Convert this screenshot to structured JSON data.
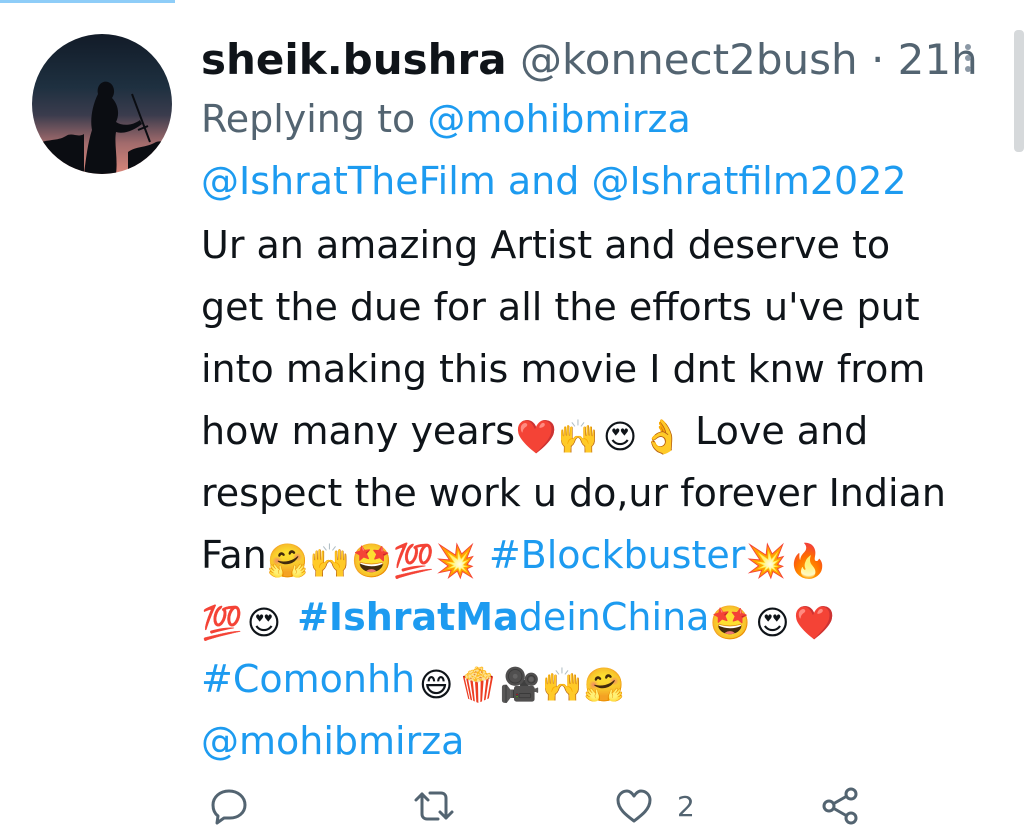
{
  "tweet": {
    "display_name": "sheik.bushra",
    "handle_time": "@konnect2bush · 21h",
    "replying_prefix": "Replying to ",
    "replying_to_1": "@mohibmirza",
    "replying_to_2": "@IshratTheFilm and @Ishratfilm2022",
    "lines": [
      "Ur an amazing Artist and deserve to",
      "get the due for all the efforts u've put",
      "into making this movie I dnt knw from",
      "how many years",
      " Love and",
      "respect the work u do,ur forever Indian",
      "Fan",
      "#Blockbuster",
      "#IshratMa",
      "deinChina",
      "#Comonhh",
      "@mohibmirza"
    ],
    "like_count": "2"
  },
  "emoji": {
    "e1": "❤️",
    "e2": "🙌",
    "e3": "😍",
    "e4": "👌",
    "e5": "🤗",
    "e6": "🙌",
    "e7": "🤩",
    "e8": "💯",
    "e9": "💥",
    "e10": "💥",
    "e11": "🔥",
    "e12": "💯",
    "e13": "😍",
    "e14": "🤩",
    "e15": "😍",
    "e16": "❤️",
    "e17": "😄",
    "e18": "🍿",
    "e19": "🎥",
    "e20": "🙌",
    "e21": "🤗"
  },
  "icons": {
    "reply": "reply-icon",
    "retweet": "retweet-icon",
    "like": "heart-icon",
    "share": "share-icon",
    "more": "more-vertical-icon"
  },
  "colors": {
    "link": "#1d9bf0",
    "secondary_text": "#536471",
    "primary_text": "#0f1419"
  }
}
